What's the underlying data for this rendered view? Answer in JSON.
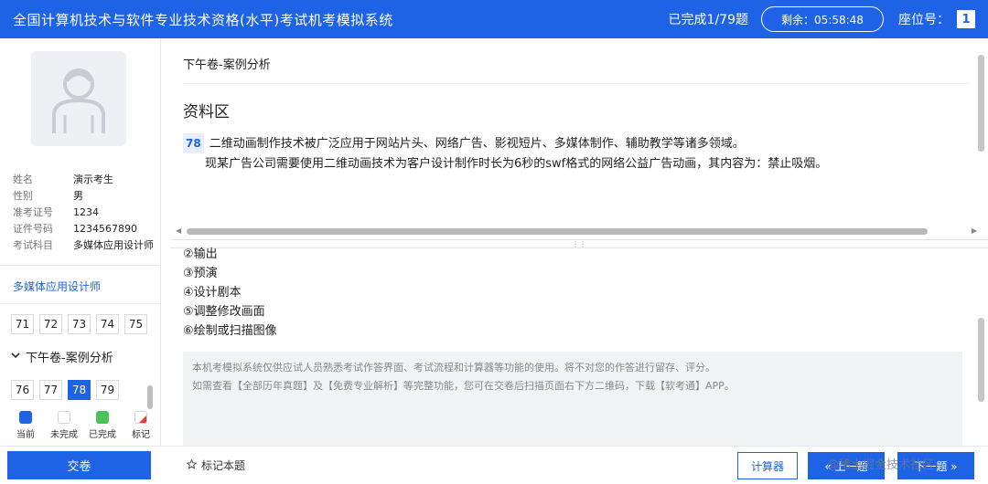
{
  "header": {
    "title": "全国计算机技术与软件专业技术资格(水平)考试机考模拟系统",
    "progress": "已完成1/79题",
    "timer": "剩余：05:58:48",
    "seat_label": "座位号：",
    "seat_number": "1"
  },
  "candidate": {
    "avatar_icon": "user-avatar-icon",
    "fields": [
      {
        "label": "姓名",
        "value": "演示考生"
      },
      {
        "label": "性别",
        "value": "男"
      },
      {
        "label": "准考证号",
        "value": "1234"
      },
      {
        "label": "证件号码",
        "value": "1234567890"
      },
      {
        "label": "考试科目",
        "value": "多媒体应用设计师"
      }
    ]
  },
  "sidebar": {
    "subject_link": "多媒体应用设计师",
    "question_row_1": [
      "71",
      "72",
      "73",
      "74",
      "75"
    ],
    "section_title": "下午卷-案例分析",
    "question_row_2": [
      "76",
      "77",
      "78",
      "79"
    ],
    "current_question": "78",
    "legend": [
      {
        "label": "当前",
        "color": "#1e63e6"
      },
      {
        "label": "未完成",
        "color": "#ffffff"
      },
      {
        "label": "已完成",
        "color": "#4cc35a"
      },
      {
        "label": "标记",
        "color": "#e53935"
      }
    ]
  },
  "main": {
    "breadcrumb": "下午卷-案例分析",
    "area_title": "资料区",
    "question_number": "78",
    "paragraph_1": "二维动画制作技术被广泛应用于网站片头、网络广告、影视短片、多媒体制作、辅助教学等诸多领域。",
    "paragraph_2": "现某广告公司需要使用二维动画技术为客户设计制作时长为6秒的swf格式的网络公益广告动画，其内容为：禁止吸烟。",
    "options": [
      "②输出",
      "③预演",
      "④设计剧本",
      "⑤调整修改画面",
      "⑥绘制或扫描图像"
    ],
    "notice_1": "本机考模拟系统仅供应试人员熟悉考试作答界面、考试流程和计算器等功能的使用。将不对您的作答进行留存、评分。",
    "notice_2": "如需查看【全部历年真题】及【免费专业解析】等完整功能，您可在交卷后扫描页面右下方二维码，下载【软考通】APP。"
  },
  "footer": {
    "submit_label": "交卷",
    "mark_label": "标记本题",
    "calculator_label": "计算器",
    "prev_label": "« 上一题",
    "next_label": "下一题 »",
    "watermark": "@稀土掘金技术社区"
  },
  "colors": {
    "accent": "#1e63e6",
    "completed": "#4cc35a",
    "marked": "#e53935"
  }
}
